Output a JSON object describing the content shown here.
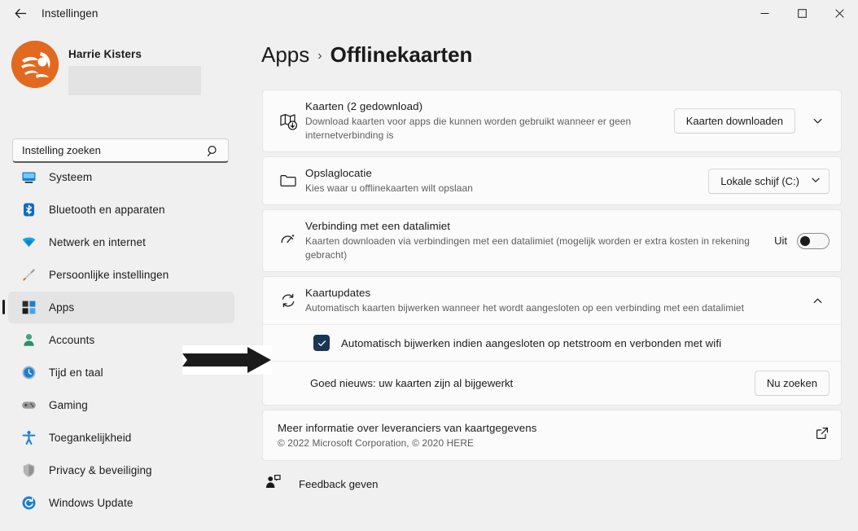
{
  "window": {
    "title": "Instellingen",
    "back_icon": "back-arrow-icon",
    "minimize_label": "Minimaliseren",
    "maximize_label": "Maximaliseren",
    "close_label": "Sluiten"
  },
  "sidebar": {
    "profile": {
      "name": "Harrie Kisters",
      "avatar_icon": "user-avatar-logo",
      "avatar_color": "#e2691f",
      "email_redacted": true
    },
    "search": {
      "placeholder": "Instelling zoeken",
      "value": "",
      "icon": "search-icon"
    },
    "items": [
      {
        "label": "Systeem",
        "icon": "monitor-icon",
        "color": "#1b7fd0",
        "active": false
      },
      {
        "label": "Bluetooth en apparaten",
        "icon": "bluetooth-icon",
        "color": "#1b7fd0",
        "active": false
      },
      {
        "label": "Netwerk en internet",
        "icon": "wifi-icon",
        "color": "#19a8e0",
        "active": false
      },
      {
        "label": "Persoonlijke instellingen",
        "icon": "paintbrush-icon",
        "color": "#e2691f",
        "active": false
      },
      {
        "label": "Apps",
        "icon": "apps-icon",
        "color": "#1b7fd0",
        "active": true
      },
      {
        "label": "Accounts",
        "icon": "person-icon",
        "color": "#2ea37c",
        "active": false
      },
      {
        "label": "Tijd en taal",
        "icon": "clock-icon",
        "color": "#1b7fd0",
        "active": false
      },
      {
        "label": "Gaming",
        "icon": "gamepad-icon",
        "color": "#8a8a8a",
        "active": false
      },
      {
        "label": "Toegankelijkheid",
        "icon": "accessibility-icon",
        "color": "#1b7fd0",
        "active": false
      },
      {
        "label": "Privacy & beveiliging",
        "icon": "shield-icon",
        "color": "#8a8a8a",
        "active": false
      },
      {
        "label": "Windows Update",
        "icon": "update-icon",
        "color": "#1b7fd0",
        "active": false
      }
    ]
  },
  "main": {
    "breadcrumb": {
      "parent": "Apps",
      "separator": "›",
      "current": "Offlinekaarten"
    },
    "cards": {
      "maps": {
        "icon": "map-download-icon",
        "title": "Kaarten (2 gedownload)",
        "subtitle": "Download kaarten voor apps die kunnen worden gebruikt wanneer er geen internetverbinding is",
        "button_label": "Kaarten downloaden",
        "expander_icon": "chevron-down-icon"
      },
      "storage": {
        "icon": "folder-icon",
        "title": "Opslaglocatie",
        "subtitle": "Kies waar u offlinekaarten wilt opslaan",
        "dropdown_value": "Lokale schijf (C:)",
        "dropdown_icon": "chevron-down-icon"
      },
      "metered": {
        "icon": "metered-connection-icon",
        "title": "Verbinding met een datalimiet",
        "subtitle": "Kaarten downloaden via verbindingen met een datalimiet (mogelijk worden er extra kosten in rekening gebracht)",
        "toggle_label": "Uit",
        "toggle_on": false
      },
      "updates": {
        "icon": "sync-icon",
        "title": "Kaartupdates",
        "subtitle": "Automatisch kaarten bijwerken wanneer het wordt aangesloten op een verbinding met een datalimiet",
        "expander_icon": "chevron-up-icon",
        "checkbox": {
          "label": "Automatisch bijwerken indien aangesloten op netstroom en verbonden met wifi",
          "checked": true,
          "color": "#193654"
        },
        "status_text": "Goed nieuws: uw kaarten zijn al bijgewerkt",
        "status_button": "Nu zoeken"
      },
      "info": {
        "title": "Meer informatie over leveranciers van kaartgegevens",
        "subtitle": "© 2022 Microsoft Corporation, © 2020 HERE",
        "link_icon": "external-link-icon"
      }
    },
    "feedback": {
      "label": "Feedback geven",
      "icon": "feedback-person-icon"
    }
  },
  "annotation": {
    "icon": "right-arrow-annotation",
    "target": "checkbox-auto-update"
  }
}
